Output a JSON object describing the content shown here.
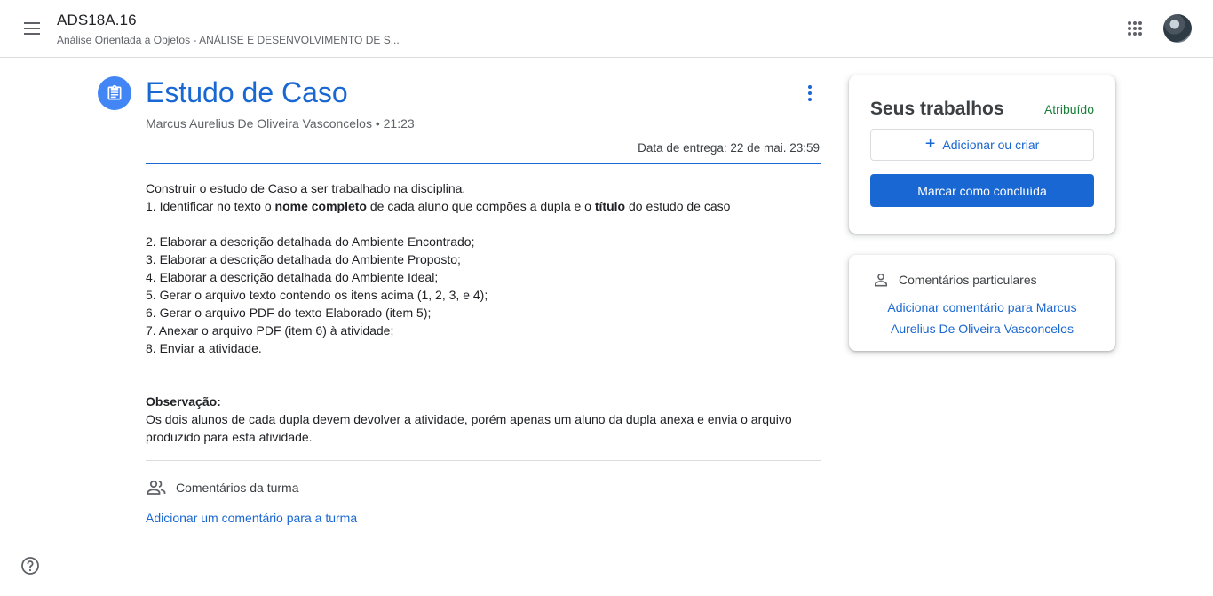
{
  "header": {
    "class_name": "ADS18A.16",
    "class_subtitle": "Análise Orientada a Objetos - ANÁLISE E DESENVOLVIMENTO DE S..."
  },
  "assignment": {
    "title": "Estudo de Caso",
    "author_line": "Marcus Aurelius De Oliveira Vasconcelos • 21:23",
    "due_line": "Data de entrega: 22 de mai. 23:59",
    "instructions": {
      "line1": "Construir o estudo de Caso a ser trabalhado na disciplina.",
      "line2_a": "1. Identificar no texto o ",
      "line2_b": "nome completo",
      "line2_c": " de cada aluno que compões a dupla e o ",
      "line2_d": "título",
      "line2_e": " do estudo de caso",
      "items": [
        "2. Elaborar a descrição detalhada do Ambiente Encontrado;",
        "3. Elaborar a descrição detalhada do Ambiente Proposto;",
        "4. Elaborar a descrição detalhada do Ambiente Ideal;",
        "5. Gerar o arquivo texto contendo os itens acima (1, 2, 3, e 4);",
        "6. Gerar o arquivo PDF do texto Elaborado (item 5);",
        "7. Anexar o arquivo PDF (item 6) à atividade;",
        "8. Enviar a atividade."
      ],
      "note_label": "Observação:",
      "note_text": "Os dois alunos de cada dupla devem devolver a atividade, porém apenas um aluno da dupla anexa e envia o arquivo produzido para esta atividade."
    },
    "class_comments_label": "Comentários da turma",
    "add_class_comment": "Adicionar um comentário para a turma"
  },
  "your_work": {
    "title": "Seus trabalhos",
    "status": "Atribuído",
    "add_create": "Adicionar ou criar",
    "mark_done": "Marcar como concluída"
  },
  "private_comments": {
    "label": "Comentários particulares",
    "add_link": "Adicionar comentário para Marcus Aurelius De Oliveira Vasconcelos"
  },
  "colors": {
    "accent": "#1967d2",
    "assigned_status": "#188038",
    "icon_blue": "#4285f4"
  },
  "icons": [
    "menu-icon",
    "apps-icon",
    "avatar",
    "assignment-icon",
    "more-vert-icon",
    "people-icon",
    "add-icon",
    "person-icon",
    "help-icon"
  ]
}
